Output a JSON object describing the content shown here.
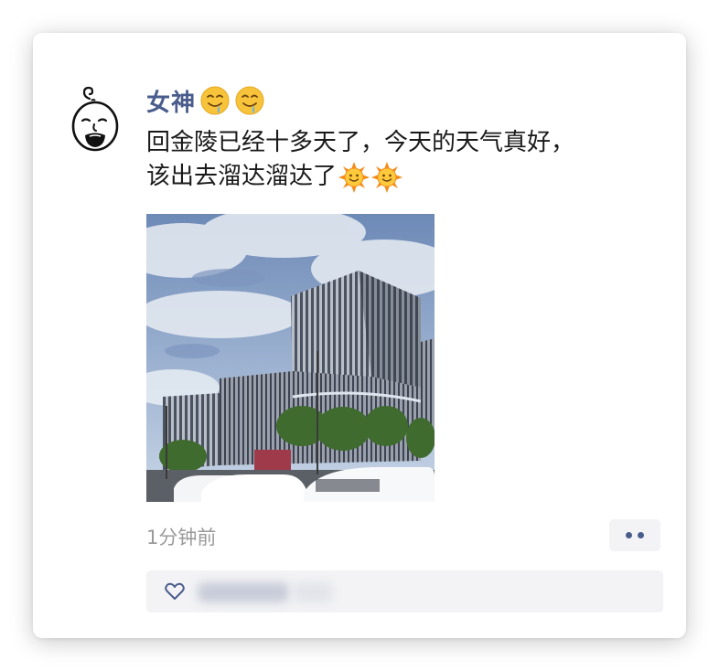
{
  "post": {
    "author": "女神",
    "author_emojis": [
      "drooling-face-icon",
      "drooling-face-icon"
    ],
    "text_line1": "回金陵已经十多天了，今天的天气真好，",
    "text_line2": "该出去溜达溜达了",
    "text_emojis": [
      "sun-with-face-icon",
      "sun-with-face-icon"
    ],
    "timestamp": "1分钟前"
  },
  "actions": {
    "more_icon": "two-dots-icon",
    "like_icon": "heart-outline-icon"
  },
  "colors": {
    "nickname": "#4a5c8c",
    "text": "#1a1a1a",
    "timestamp": "#9a9a9a",
    "panel_bg": "#f3f3f5"
  }
}
